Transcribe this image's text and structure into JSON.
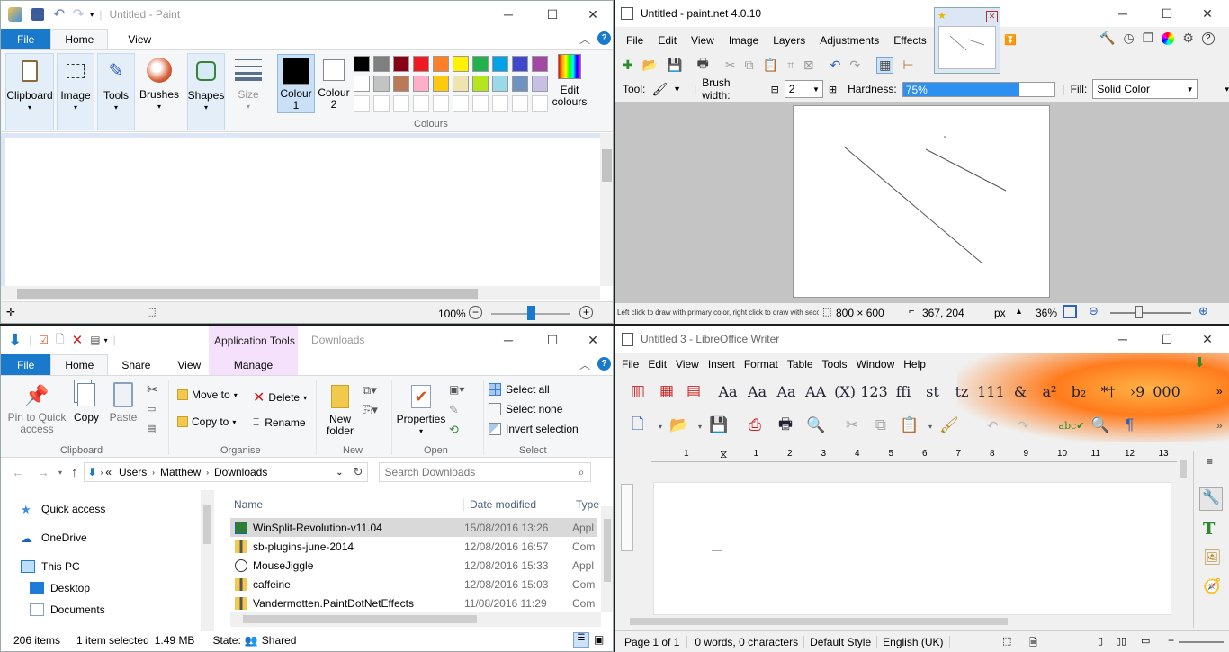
{
  "paint": {
    "title": "Untitled - Paint",
    "tabs": [
      "File",
      "Home",
      "View"
    ],
    "groups": {
      "clipboard": "Clipboard",
      "image": "Image",
      "tools": "Tools",
      "brushes": "Brushes",
      "shapes": "Shapes",
      "size": "Size",
      "colour1": "Colour 1",
      "colour2": "Colour 2",
      "colours": "Colours",
      "edit_colours": "Edit colours"
    },
    "palette_row1": [
      "#000000",
      "#7f7f7f",
      "#880015",
      "#ed1c24",
      "#ff7f27",
      "#fff200",
      "#22b14c",
      "#00a2e8",
      "#3f48cc",
      "#a349a4"
    ],
    "palette_row2": [
      "#ffffff",
      "#c3c3c3",
      "#b97a57",
      "#ffaec9",
      "#ffc90e",
      "#efe4b0",
      "#b5e61d",
      "#99d9ea",
      "#7092be",
      "#c8bfe7"
    ],
    "status": {
      "zoom": "100%"
    }
  },
  "pdn": {
    "title": "Untitled - paint.net 4.0.10",
    "menu": [
      "File",
      "Edit",
      "View",
      "Image",
      "Layers",
      "Adjustments",
      "Effects"
    ],
    "tool_label": "Tool:",
    "brush_width_label": "Brush width:",
    "brush_width_value": "2",
    "hardness_label": "Hardness:",
    "hardness_value": "75%",
    "hardness_fraction": 0.75,
    "fill_label": "Fill:",
    "fill_value": "Solid Color",
    "status_hint": "Left click to draw with primary color, right click to draw with second...",
    "image_size": "800 × 600",
    "cursor_pos": "367, 204",
    "unit": "px",
    "zoom": "36%"
  },
  "explorer": {
    "title": "Downloads",
    "context_tab": "Application Tools",
    "tabs": [
      "File",
      "Home",
      "Share",
      "View",
      "Manage"
    ],
    "buttons": {
      "pin": "Pin to Quick access",
      "copy": "Copy",
      "paste": "Paste",
      "move_to": "Move to",
      "copy_to": "Copy to",
      "delete": "Delete",
      "rename": "Rename",
      "new_folder": "New folder",
      "properties": "Properties",
      "select_all": "Select all",
      "select_none": "Select none",
      "invert": "Invert selection"
    },
    "groups": {
      "clipboard": "Clipboard",
      "organise": "Organise",
      "new": "New",
      "open": "Open",
      "select": "Select"
    },
    "breadcrumb": [
      "«",
      "Users",
      "Matthew",
      "Downloads"
    ],
    "search_placeholder": "Search Downloads",
    "nav": [
      "Quick access",
      "OneDrive",
      "This PC",
      "Desktop",
      "Documents"
    ],
    "columns": [
      "Name",
      "Date modified",
      "Type"
    ],
    "files": [
      {
        "name": "WinSplit-Revolution-v11.04",
        "date": "15/08/2016 13:26",
        "type": "Appl"
      },
      {
        "name": "sb-plugins-june-2014",
        "date": "12/08/2016 16:57",
        "type": "Comp"
      },
      {
        "name": "MouseJiggle",
        "date": "12/08/2016 15:33",
        "type": "Appl"
      },
      {
        "name": "caffeine",
        "date": "12/08/2016 15:03",
        "type": "Comp"
      },
      {
        "name": "Vandermotten.PaintDotNetEffects",
        "date": "11/08/2016 11:29",
        "type": "Comp"
      }
    ],
    "status": {
      "count": "206 items",
      "selected": "1 item selected",
      "size": "1.49 MB",
      "state_label": "State:",
      "state_value": "Shared"
    }
  },
  "writer": {
    "title": "Untitled 3 - LibreOffice Writer",
    "menu": [
      "File",
      "Edit",
      "View",
      "Insert",
      "Format",
      "Table",
      "Tools",
      "Window",
      "Help"
    ],
    "format_buttons": [
      "Aa",
      "Aa",
      "Aa",
      "AA",
      "(X)",
      "123",
      "ffi",
      "st",
      "tz",
      "111",
      "&",
      "a²",
      "b₂",
      "*†",
      "›9",
      "000"
    ],
    "ruler": [
      "1",
      "1",
      "2",
      "3",
      "4",
      "5",
      "6",
      "7",
      "8",
      "9",
      "10",
      "11",
      "12",
      "13"
    ],
    "status": {
      "page": "Page 1 of 1",
      "words": "0 words, 0 characters",
      "style": "Default Style",
      "lang": "English (UK)"
    }
  }
}
